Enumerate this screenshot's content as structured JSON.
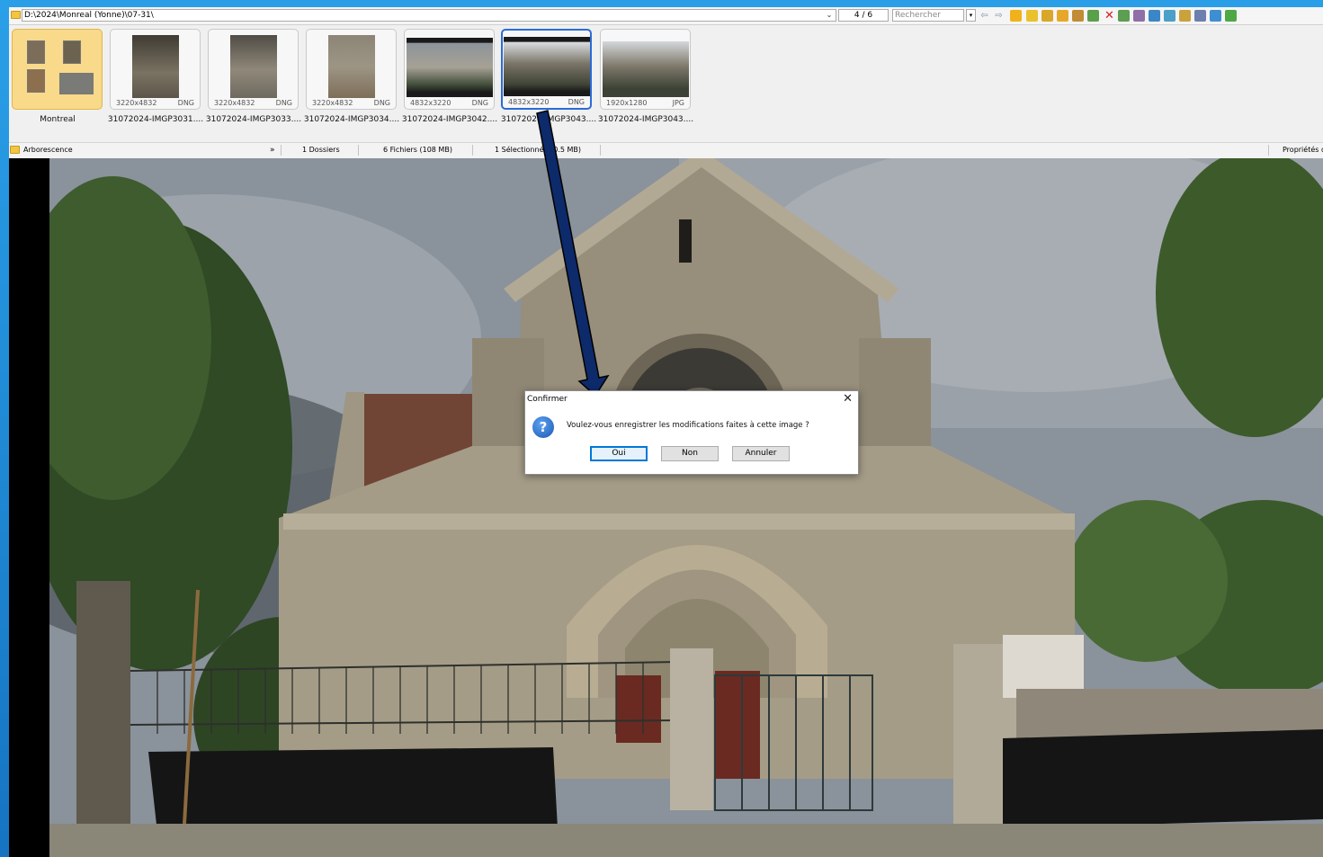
{
  "toolbar": {
    "path": "D:\\2024\\Monreal (Yonne)\\07-31\\",
    "counter": "4 / 6",
    "search_placeholder": "Rechercher"
  },
  "thumbnails": [
    {
      "label": "Montreal",
      "dims": "",
      "format": ""
    },
    {
      "label": "31072024-IMGP3031....",
      "dims": "3220x4832",
      "format": "DNG"
    },
    {
      "label": "31072024-IMGP3033....",
      "dims": "3220x4832",
      "format": "DNG"
    },
    {
      "label": "31072024-IMGP3034....",
      "dims": "3220x4832",
      "format": "DNG"
    },
    {
      "label": "31072024-IMGP3042....",
      "dims": "4832x3220",
      "format": "DNG"
    },
    {
      "label": "31072024-IMGP3043....",
      "dims": "4832x3220",
      "format": "DNG"
    },
    {
      "label": "31072024-IMGP3043....",
      "dims": "1920x1280",
      "format": "JPG"
    }
  ],
  "statusbar": {
    "tree": "Arborescence",
    "folders": "1 Dossiers",
    "files": "6 Fichiers (108 MB)",
    "selection": "1 Sélectionné (20.5 MB)",
    "properties": "Propriétés d"
  },
  "dialog": {
    "title": "Confirmer",
    "message": "Voulez-vous enregistrer les modifications faites à cette image ?",
    "yes": "Oui",
    "no": "Non",
    "cancel": "Annuler"
  },
  "colors": {
    "accent": "#2b6bd6",
    "arrow": "#0d2a6b",
    "desktop": "#1f8ad6"
  }
}
